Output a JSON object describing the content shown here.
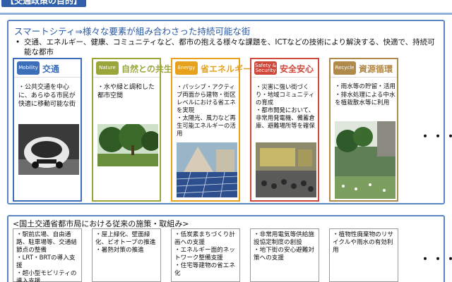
{
  "header": {
    "title_fragment": "【交通政策の目的】"
  },
  "main": {
    "heading": "スマートシティ⇒様々な要素が組み合わさった持続可能な街",
    "bullet": "交通、エネルギー、健康、コミュニティなど、都市の抱える様々な課題を、ICTなどの技術により解決する、快適で、持続可能な都市"
  },
  "cards": [
    {
      "badge": "Mobility",
      "title": "交通",
      "color": "#3d6fb8",
      "desc": "・公共交通を中心に、あらゆる市民が快適に移動可能な街"
    },
    {
      "badge": "Nature",
      "title": "自然との共生",
      "color": "#9aa63a",
      "desc": "・水や緑と調和した都市空間"
    },
    {
      "badge": "Energy",
      "title": "省エネルギー",
      "color": "#e6a21c",
      "desc": "・パッシブ・アクティブ両面から建物・街区レベルにおける省エネを実現\n・太陽光、風力など再生可能エネルギーの活用"
    },
    {
      "badge": "Safety & Security",
      "title": "安全安心",
      "color": "#d0483a",
      "desc": "・災害に強い街づくり・地域コミュニティの育成\n・都市開発において、非常用発電機、備蓄倉庫、避難場所等を確保"
    },
    {
      "badge": "Recycle",
      "title": "資源循環",
      "color": "#b08a4a",
      "desc": "・雨水等の貯留・活用\n・排水処理による中水を植栽散水等に利用"
    }
  ],
  "ellipsis": "・・・",
  "bottom": {
    "heading": "<国土交通省都市局における従来の施策・取組み>",
    "items": [
      [
        "・駅前広場、自由通路、駐車場等、交通結節点の整備",
        "・LRT・BRTの導入支援",
        "・超小型モビリティの導入支援"
      ],
      [
        "・屋上緑化、壁面緑化、ビオトープの推進",
        "・暑熱対策の推進"
      ],
      [
        "・低炭素まちづくり計画への支援",
        "・エネルギー面的ネットワーク整備支援",
        "・住宅等建物の省エネ化"
      ],
      [
        "・非常用電気等供給施設協定制度の創設",
        "・地下街の安心避難対策への支援"
      ],
      [
        "・植物性廃棄物のリサイクルや雨水の有効利用"
      ]
    ]
  }
}
